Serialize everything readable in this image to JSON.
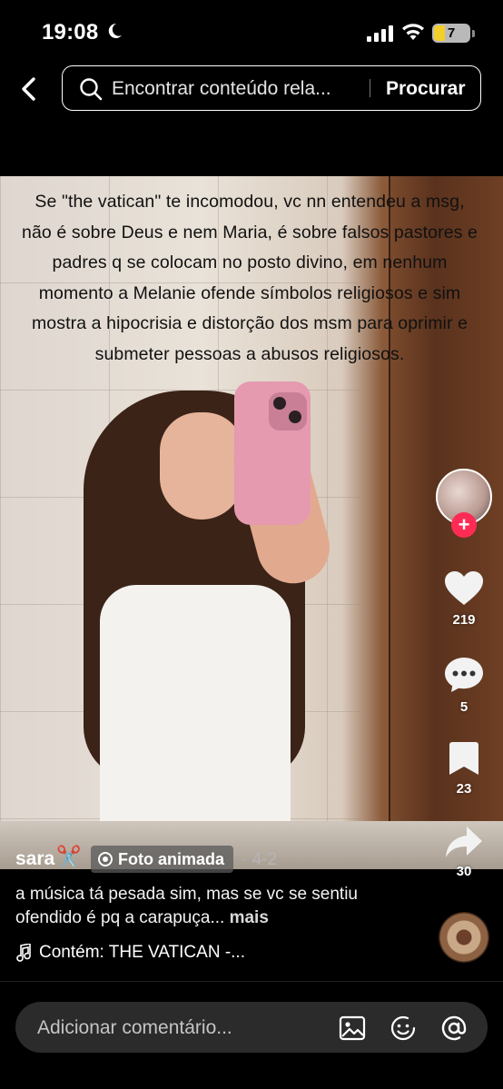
{
  "status_bar": {
    "time": "19:08",
    "battery": "7"
  },
  "search": {
    "placeholder": "Encontrar conteúdo rela...",
    "button": "Procurar"
  },
  "post": {
    "overlay_text": "Se \"the vatican\" te incomodou, vc nn entendeu a msg, não é sobre Deus e nem Maria, é sobre falsos pastores e padres q se colocam no posto divino, em nenhum momento a Melanie ofende símbolos religiosos e sim mostra a hipocrisia e distorção dos msm para oprimir e submeter pessoas a abusos religiosos.",
    "username": "sara",
    "username_emoji": "✂️",
    "tag": "Foto animada",
    "date": "· 4-2",
    "caption": "a música tá pesada sim, mas se vc se sentiu ofendido é pq a carapuça...",
    "caption_more": "mais",
    "music": "Contém: THE VATICAN -..."
  },
  "actions": {
    "likes": "219",
    "comments": "5",
    "saves": "23",
    "shares": "30"
  },
  "comment_bar": {
    "placeholder": "Adicionar comentário..."
  },
  "colors": {
    "accent": "#fe2c55",
    "background": "#000000"
  },
  "icons": [
    "moon-icon",
    "signal-icon",
    "wifi-icon",
    "back-arrow-icon",
    "search-icon",
    "heart-icon",
    "comment-icon",
    "bookmark-icon",
    "share-icon",
    "music-note-icon",
    "image-icon",
    "emoji-icon",
    "mention-icon"
  ]
}
